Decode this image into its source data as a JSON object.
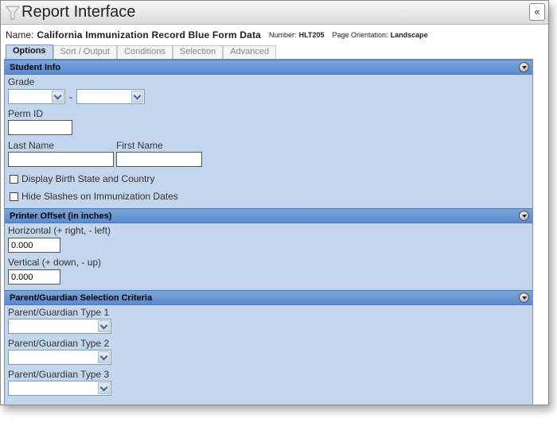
{
  "window": {
    "title": "Report Interface",
    "collapse_glyph": "«"
  },
  "report": {
    "name_label": "Name:",
    "name": "California Immunization Record Blue Form Data",
    "number_label": "Number:",
    "number": "HLT205",
    "orientation_label": "Page Orientation:",
    "orientation": "Landscape"
  },
  "tabs": [
    {
      "label": "Options",
      "active": true
    },
    {
      "label": "Sort / Output",
      "active": false
    },
    {
      "label": "Conditions",
      "active": false
    },
    {
      "label": "Selection",
      "active": false
    },
    {
      "label": "Advanced",
      "active": false
    }
  ],
  "student_info": {
    "title": "Student Info",
    "grade_label": "Grade",
    "grade_from": "",
    "grade_sep": "-",
    "grade_to": "",
    "perm_id_label": "Perm ID",
    "perm_id": "",
    "last_name_label": "Last Name",
    "last_name": "",
    "first_name_label": "First Name",
    "first_name": "",
    "display_birth_label": "Display Birth State and Country",
    "hide_slashes_label": "Hide Slashes on Immunization Dates"
  },
  "printer_offset": {
    "title": "Printer Offset (in inches)",
    "horizontal_label": "Horizontal (+ right, - left)",
    "horizontal_value": "0.000",
    "vertical_label": "Vertical (+ down, - up)",
    "vertical_value": "0.000"
  },
  "guardian": {
    "title": "Parent/Guardian Selection Criteria",
    "type1_label": "Parent/Guardian Type 1",
    "type2_label": "Parent/Guardian Type 2",
    "type3_label": "Parent/Guardian Type 3"
  },
  "colors": {
    "panel_bg": "#c4d6ed",
    "header_bg": "#5a8ad0",
    "active_tab_bg": "#c7d8ee"
  },
  "icons": {
    "title_icon": "funnel-icon",
    "section_toggle": "collapse-circle-icon",
    "dropdown": "chevron-down-icon"
  }
}
